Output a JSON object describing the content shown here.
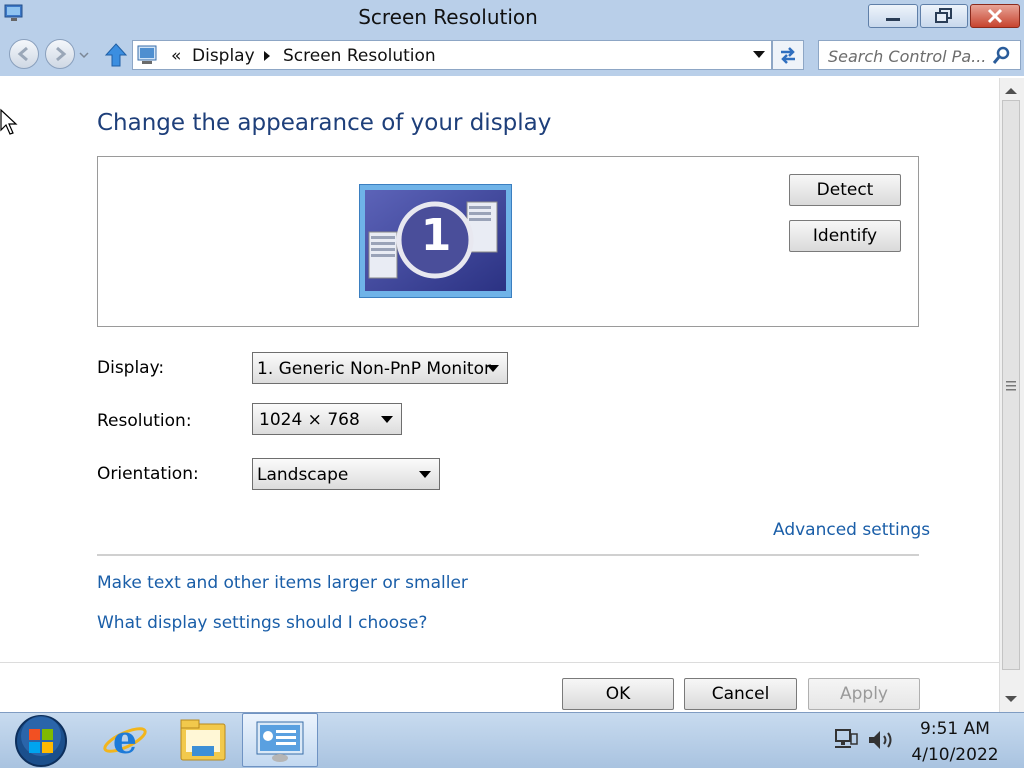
{
  "window": {
    "title": "Screen Resolution"
  },
  "navigation": {
    "breadcrumb_prefix": "«",
    "breadcrumbs": [
      "Display",
      "Screen Resolution"
    ],
    "search_placeholder": "Search Control Pa..."
  },
  "main": {
    "heading": "Change the appearance of your display",
    "monitor_number": "1",
    "detect_label": "Detect",
    "identify_label": "Identify",
    "display_label": "Display:",
    "display_value": "1. Generic Non-PnP Monitor",
    "resolution_label": "Resolution:",
    "resolution_value": "1024 × 768",
    "orientation_label": "Orientation:",
    "orientation_value": "Landscape",
    "advanced_link": "Advanced settings",
    "links": [
      "Make text and other items larger or smaller",
      "What display settings should I choose?"
    ]
  },
  "footer": {
    "ok_label": "OK",
    "cancel_label": "Cancel",
    "apply_label": "Apply"
  },
  "taskbar": {
    "time": "9:51 AM",
    "date": "4/10/2022",
    "items": [
      "start-orb-icon",
      "internet-explorer-icon",
      "file-explorer-icon",
      "control-panel-display-icon"
    ]
  },
  "colors": {
    "link": "#1a5ea8",
    "heading": "#1e3f7a",
    "chrome": "#b9cfe9"
  }
}
